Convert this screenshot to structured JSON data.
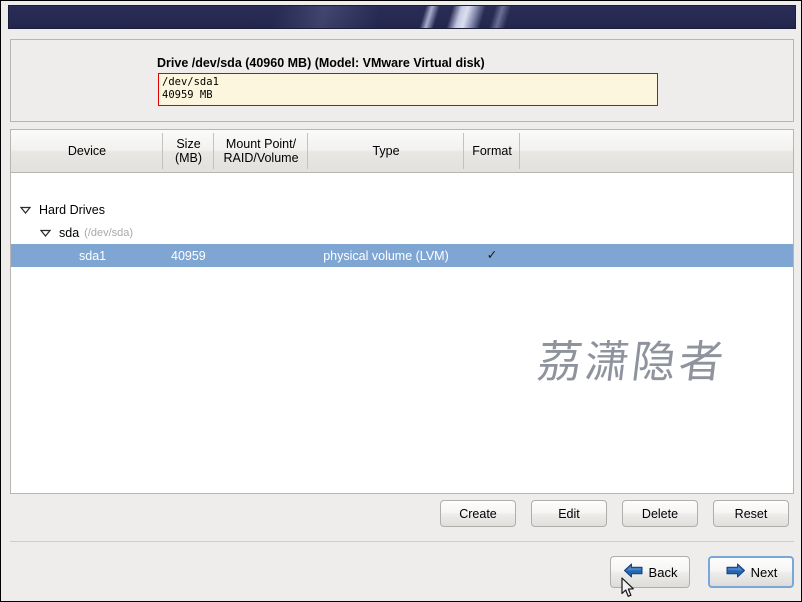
{
  "window": {
    "titlebar_label": ""
  },
  "drive": {
    "title": "Drive /dev/sda (40960 MB) (Model: VMware Virtual disk)",
    "bar": {
      "name": "/dev/sda1",
      "size": "40959 MB"
    },
    "colors": {
      "bar_fill": "#fdf6de",
      "bar_border": "#e00000",
      "titlebar": "#2a2c55",
      "selection": "#7fa6d3"
    }
  },
  "table": {
    "columns": [
      {
        "label_line1": "Device",
        "label_line2": ""
      },
      {
        "label_line1": "Size",
        "label_line2": "(MB)"
      },
      {
        "label_line1": "Mount Point/",
        "label_line2": "RAID/Volume"
      },
      {
        "label_line1": "Type",
        "label_line2": ""
      },
      {
        "label_line1": "Format",
        "label_line2": ""
      }
    ],
    "rows": [
      {
        "device": "Hard Drives",
        "device_dim": "",
        "size": "",
        "mount": "",
        "type": "",
        "format": "",
        "selected": false,
        "expander": "chevron-down-icon"
      },
      {
        "device": "sda",
        "device_dim": "(/dev/sda)",
        "size": "",
        "mount": "",
        "type": "",
        "format": "",
        "selected": false,
        "expander": "chevron-down-icon"
      },
      {
        "device": "sda1",
        "device_dim": "",
        "size": "40959",
        "mount": "",
        "type": "physical volume (LVM)",
        "format": "✓",
        "selected": true,
        "expander": ""
      }
    ]
  },
  "watermark": {
    "text": "茘潇隐者"
  },
  "actions": {
    "create": "Create",
    "edit": "Edit",
    "delete": "Delete",
    "reset": "Reset"
  },
  "navigation": {
    "back": "Back",
    "next": "Next",
    "back_icon": "arrow-left-icon",
    "next_icon": "arrow-right-icon",
    "next_focused": true
  }
}
